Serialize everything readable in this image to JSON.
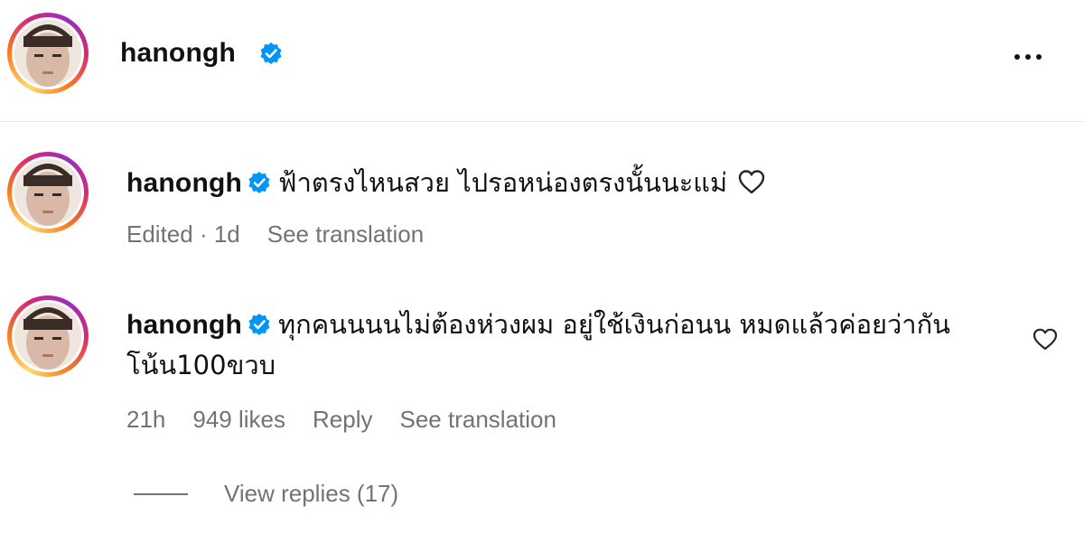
{
  "header": {
    "username": "hanongh",
    "more_label": "More options"
  },
  "comments": [
    {
      "username": "hanongh",
      "text": "ฟ้าตรงไหนสวย ไปรอหน่องตรงนั้นนะแม่",
      "meta": {
        "edited": "Edited · 1d",
        "see_translation": "See translation"
      }
    },
    {
      "username": "hanongh",
      "text": "ทุกคนนนนไม่ต้องห่วงผม อยู่ใช้เงินก่อนน หมดแล้วค่อยว่ากัน โน้น100ขวบ",
      "meta": {
        "time": "21h",
        "likes": "949 likes",
        "reply": "Reply",
        "see_translation": "See translation"
      },
      "view_replies": "View replies (17)"
    }
  ],
  "colors": {
    "verified": "#0095f6",
    "meta_text": "#737373",
    "divider": "#e4e4e4"
  },
  "icons": {
    "verified": "verified-badge-icon",
    "like": "heart-outline-icon",
    "more": "more-horizontal-icon"
  }
}
